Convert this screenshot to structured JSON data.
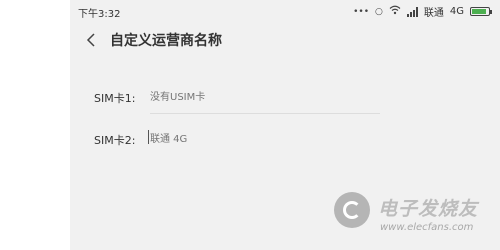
{
  "status_bar": {
    "time": "下午3:32",
    "carrier": "联通",
    "network": "4G",
    "battery_level": 0.9,
    "icons": [
      "more-dots-icon",
      "alarm-icon",
      "wifi-icon",
      "signal-icon",
      "battery-icon"
    ]
  },
  "header": {
    "title": "自定义运营商名称",
    "back_icon": "chevron-left-icon"
  },
  "sim1": {
    "label": "SIM卡1:",
    "placeholder": "没有USIM卡"
  },
  "sim2": {
    "label": "SIM卡2:",
    "placeholder": "联通 4G"
  },
  "watermark": {
    "title": "电子发烧友",
    "url": "www.elecfans.com"
  },
  "colors": {
    "screen_bg": "#f1f1f1",
    "battery_green": "#4caf50",
    "placeholder_gray": "#999999"
  }
}
